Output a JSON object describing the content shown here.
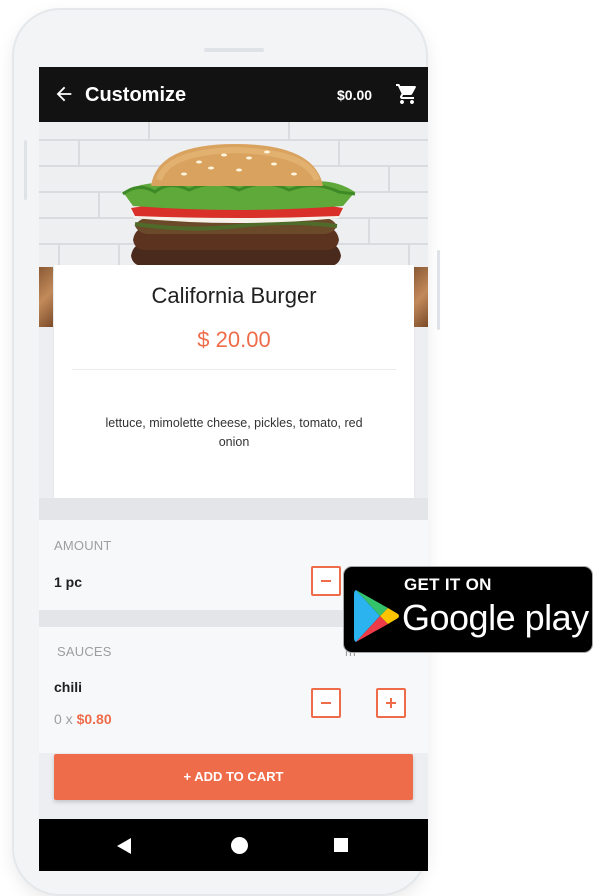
{
  "appbar": {
    "title": "Customize",
    "cart_total": "$0.00"
  },
  "product": {
    "name": "California Burger",
    "price": "$ 20.00",
    "description": "lettuce, mimolette cheese, pickles, tomato, red onion"
  },
  "amount": {
    "label": "AMOUNT",
    "value": "1 pc"
  },
  "sauces": {
    "label": "SAUCES",
    "right_hint": "m",
    "item_name": "chili",
    "item_qty": "0 x",
    "item_price": "$0.80"
  },
  "add_to_cart_label": "+ ADD TO CART",
  "store_badge": {
    "top": "GET IT ON",
    "bottom": "Google play"
  },
  "colors": {
    "accent": "#ef6c4a",
    "appbar": "#121212"
  }
}
